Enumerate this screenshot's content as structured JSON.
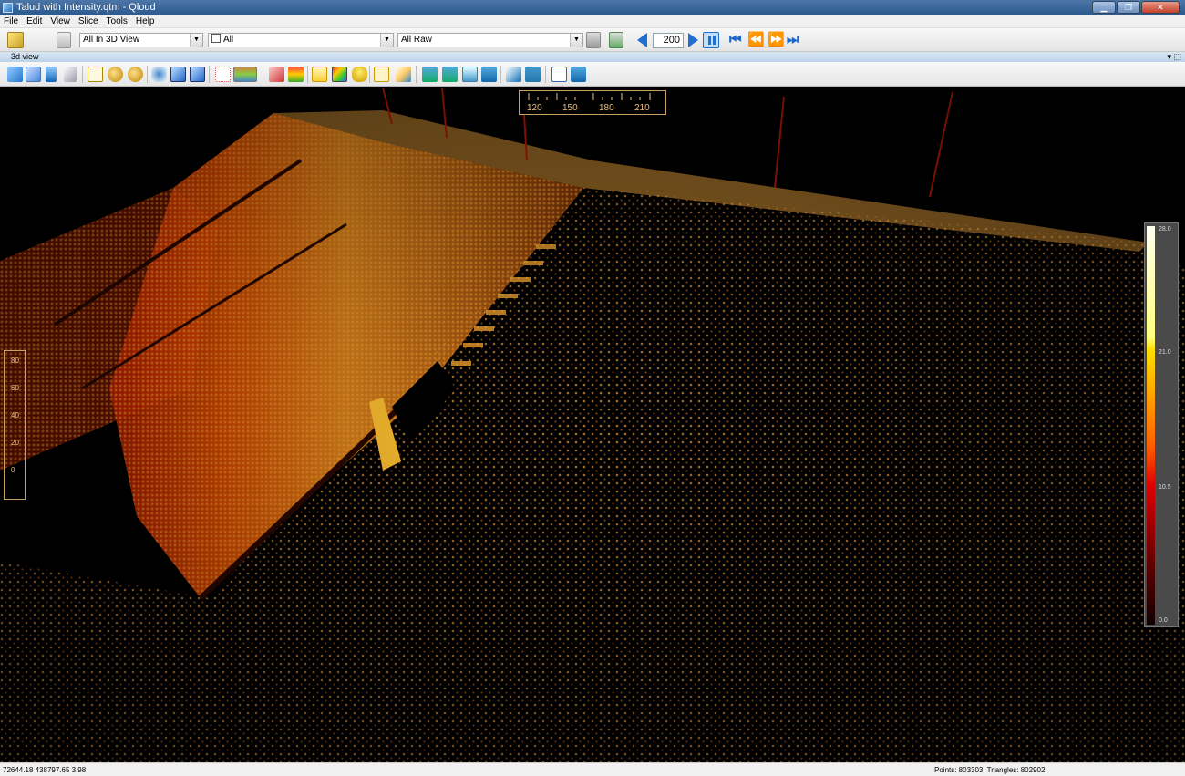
{
  "window": {
    "title": "Talud with Intensity.qtm - Qloud"
  },
  "menu": {
    "items": [
      "File",
      "Edit",
      "View",
      "Slice",
      "Tools",
      "Help"
    ]
  },
  "toolbar": {
    "view_combo": "All In 3D View",
    "all_checkbox_label": "All",
    "raw_combo": "All Raw",
    "frame_value": "200"
  },
  "view_panel": {
    "title": "3d view",
    "controls": "▾ ⬚"
  },
  "scale_x": {
    "labels": [
      "120",
      "150",
      "180",
      "210"
    ]
  },
  "scale_z": {
    "labels": [
      "80",
      "60",
      "40",
      "20",
      "0"
    ]
  },
  "colorbar": {
    "labels": [
      "28.0",
      "21.0",
      "10.5",
      "0.0"
    ]
  },
  "status": {
    "coordinates": "72644.18 438797.65 3.98",
    "counts": "Points: 803303, Triangles: 802902"
  },
  "colors": {
    "background": "#000000",
    "accent": "#1e6fd0",
    "cloud_hot": "#ff8c1a",
    "cloud_cold": "#7a1a00"
  }
}
